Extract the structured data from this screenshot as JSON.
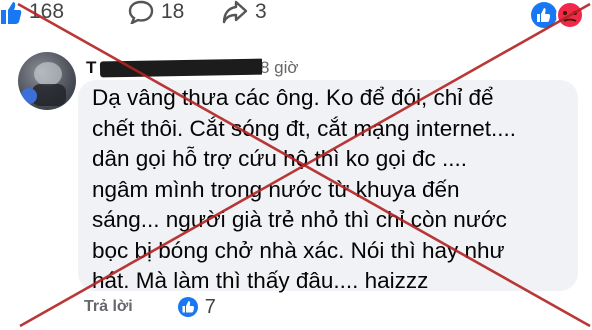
{
  "post_stats": {
    "likes": "168",
    "comments": "18",
    "shares": "3",
    "like_icon": "like-thumb-icon",
    "comment_icon": "comment-bubble-icon",
    "share_icon": "share-arrow-icon"
  },
  "comment": {
    "author_initial": "T",
    "time": "8 giờ",
    "text": "Dạ vâng thưa các ông. Ko để đói, chỉ để\nchết thôi. Cắt sóng đt, cắt mạng internet....\ndân gọi hỗ trợ cứu hộ thì ko gọi đc ....\nngâm mình trong nước từ khuya đến\nsáng... người già trẻ nhỏ thì chỉ còn nước\nbọc bị bóng chở nhà xác. Nói thì hay như\nhát. Mà làm thì thấy đâu.... haizzz",
    "reply_label": "Trả lời",
    "reaction_count": "7"
  },
  "colors": {
    "facebook_blue": "#1877f2",
    "angry_red": "#f02849",
    "overlay_red": "#b32222",
    "bubble_bg": "#f0f2f5"
  }
}
